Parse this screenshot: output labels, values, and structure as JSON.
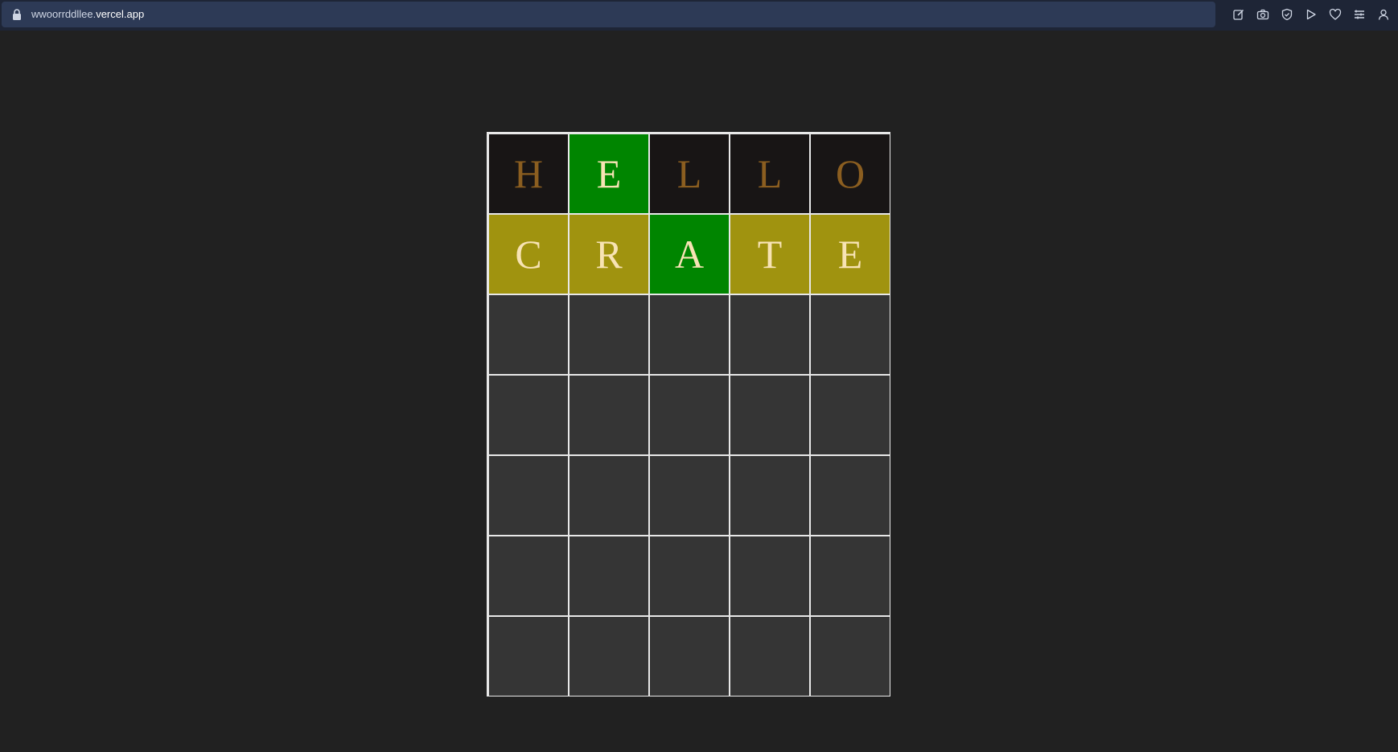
{
  "browser": {
    "url_prefix": "wwoorrddllee.",
    "url_domain": "vercel.app",
    "toolbar_icons": [
      "edit-icon",
      "camera-icon",
      "shield-icon",
      "play-icon",
      "heart-icon",
      "menu-icon",
      "profile-icon"
    ]
  },
  "colors": {
    "background": "#212121",
    "absent": "#181515",
    "correct": "#008500",
    "present": "#a0930f",
    "empty": "#353535",
    "absent_text": "#8b5e20",
    "tile_text": "#f7e3b4",
    "border": "#e8e8e8"
  },
  "board": {
    "rows": [
      [
        {
          "letter": "H",
          "state": "absent"
        },
        {
          "letter": "E",
          "state": "correct"
        },
        {
          "letter": "L",
          "state": "absent"
        },
        {
          "letter": "L",
          "state": "absent"
        },
        {
          "letter": "O",
          "state": "absent"
        }
      ],
      [
        {
          "letter": "C",
          "state": "present"
        },
        {
          "letter": "R",
          "state": "present"
        },
        {
          "letter": "A",
          "state": "correct"
        },
        {
          "letter": "T",
          "state": "present"
        },
        {
          "letter": "E",
          "state": "present"
        }
      ],
      [
        {
          "letter": "",
          "state": "empty"
        },
        {
          "letter": "",
          "state": "empty"
        },
        {
          "letter": "",
          "state": "empty"
        },
        {
          "letter": "",
          "state": "empty"
        },
        {
          "letter": "",
          "state": "empty"
        }
      ],
      [
        {
          "letter": "",
          "state": "empty"
        },
        {
          "letter": "",
          "state": "empty"
        },
        {
          "letter": "",
          "state": "empty"
        },
        {
          "letter": "",
          "state": "empty"
        },
        {
          "letter": "",
          "state": "empty"
        }
      ],
      [
        {
          "letter": "",
          "state": "empty"
        },
        {
          "letter": "",
          "state": "empty"
        },
        {
          "letter": "",
          "state": "empty"
        },
        {
          "letter": "",
          "state": "empty"
        },
        {
          "letter": "",
          "state": "empty"
        }
      ],
      [
        {
          "letter": "",
          "state": "empty"
        },
        {
          "letter": "",
          "state": "empty"
        },
        {
          "letter": "",
          "state": "empty"
        },
        {
          "letter": "",
          "state": "empty"
        },
        {
          "letter": "",
          "state": "empty"
        }
      ],
      [
        {
          "letter": "",
          "state": "empty"
        },
        {
          "letter": "",
          "state": "empty"
        },
        {
          "letter": "",
          "state": "empty"
        },
        {
          "letter": "",
          "state": "empty"
        },
        {
          "letter": "",
          "state": "empty"
        }
      ]
    ]
  }
}
